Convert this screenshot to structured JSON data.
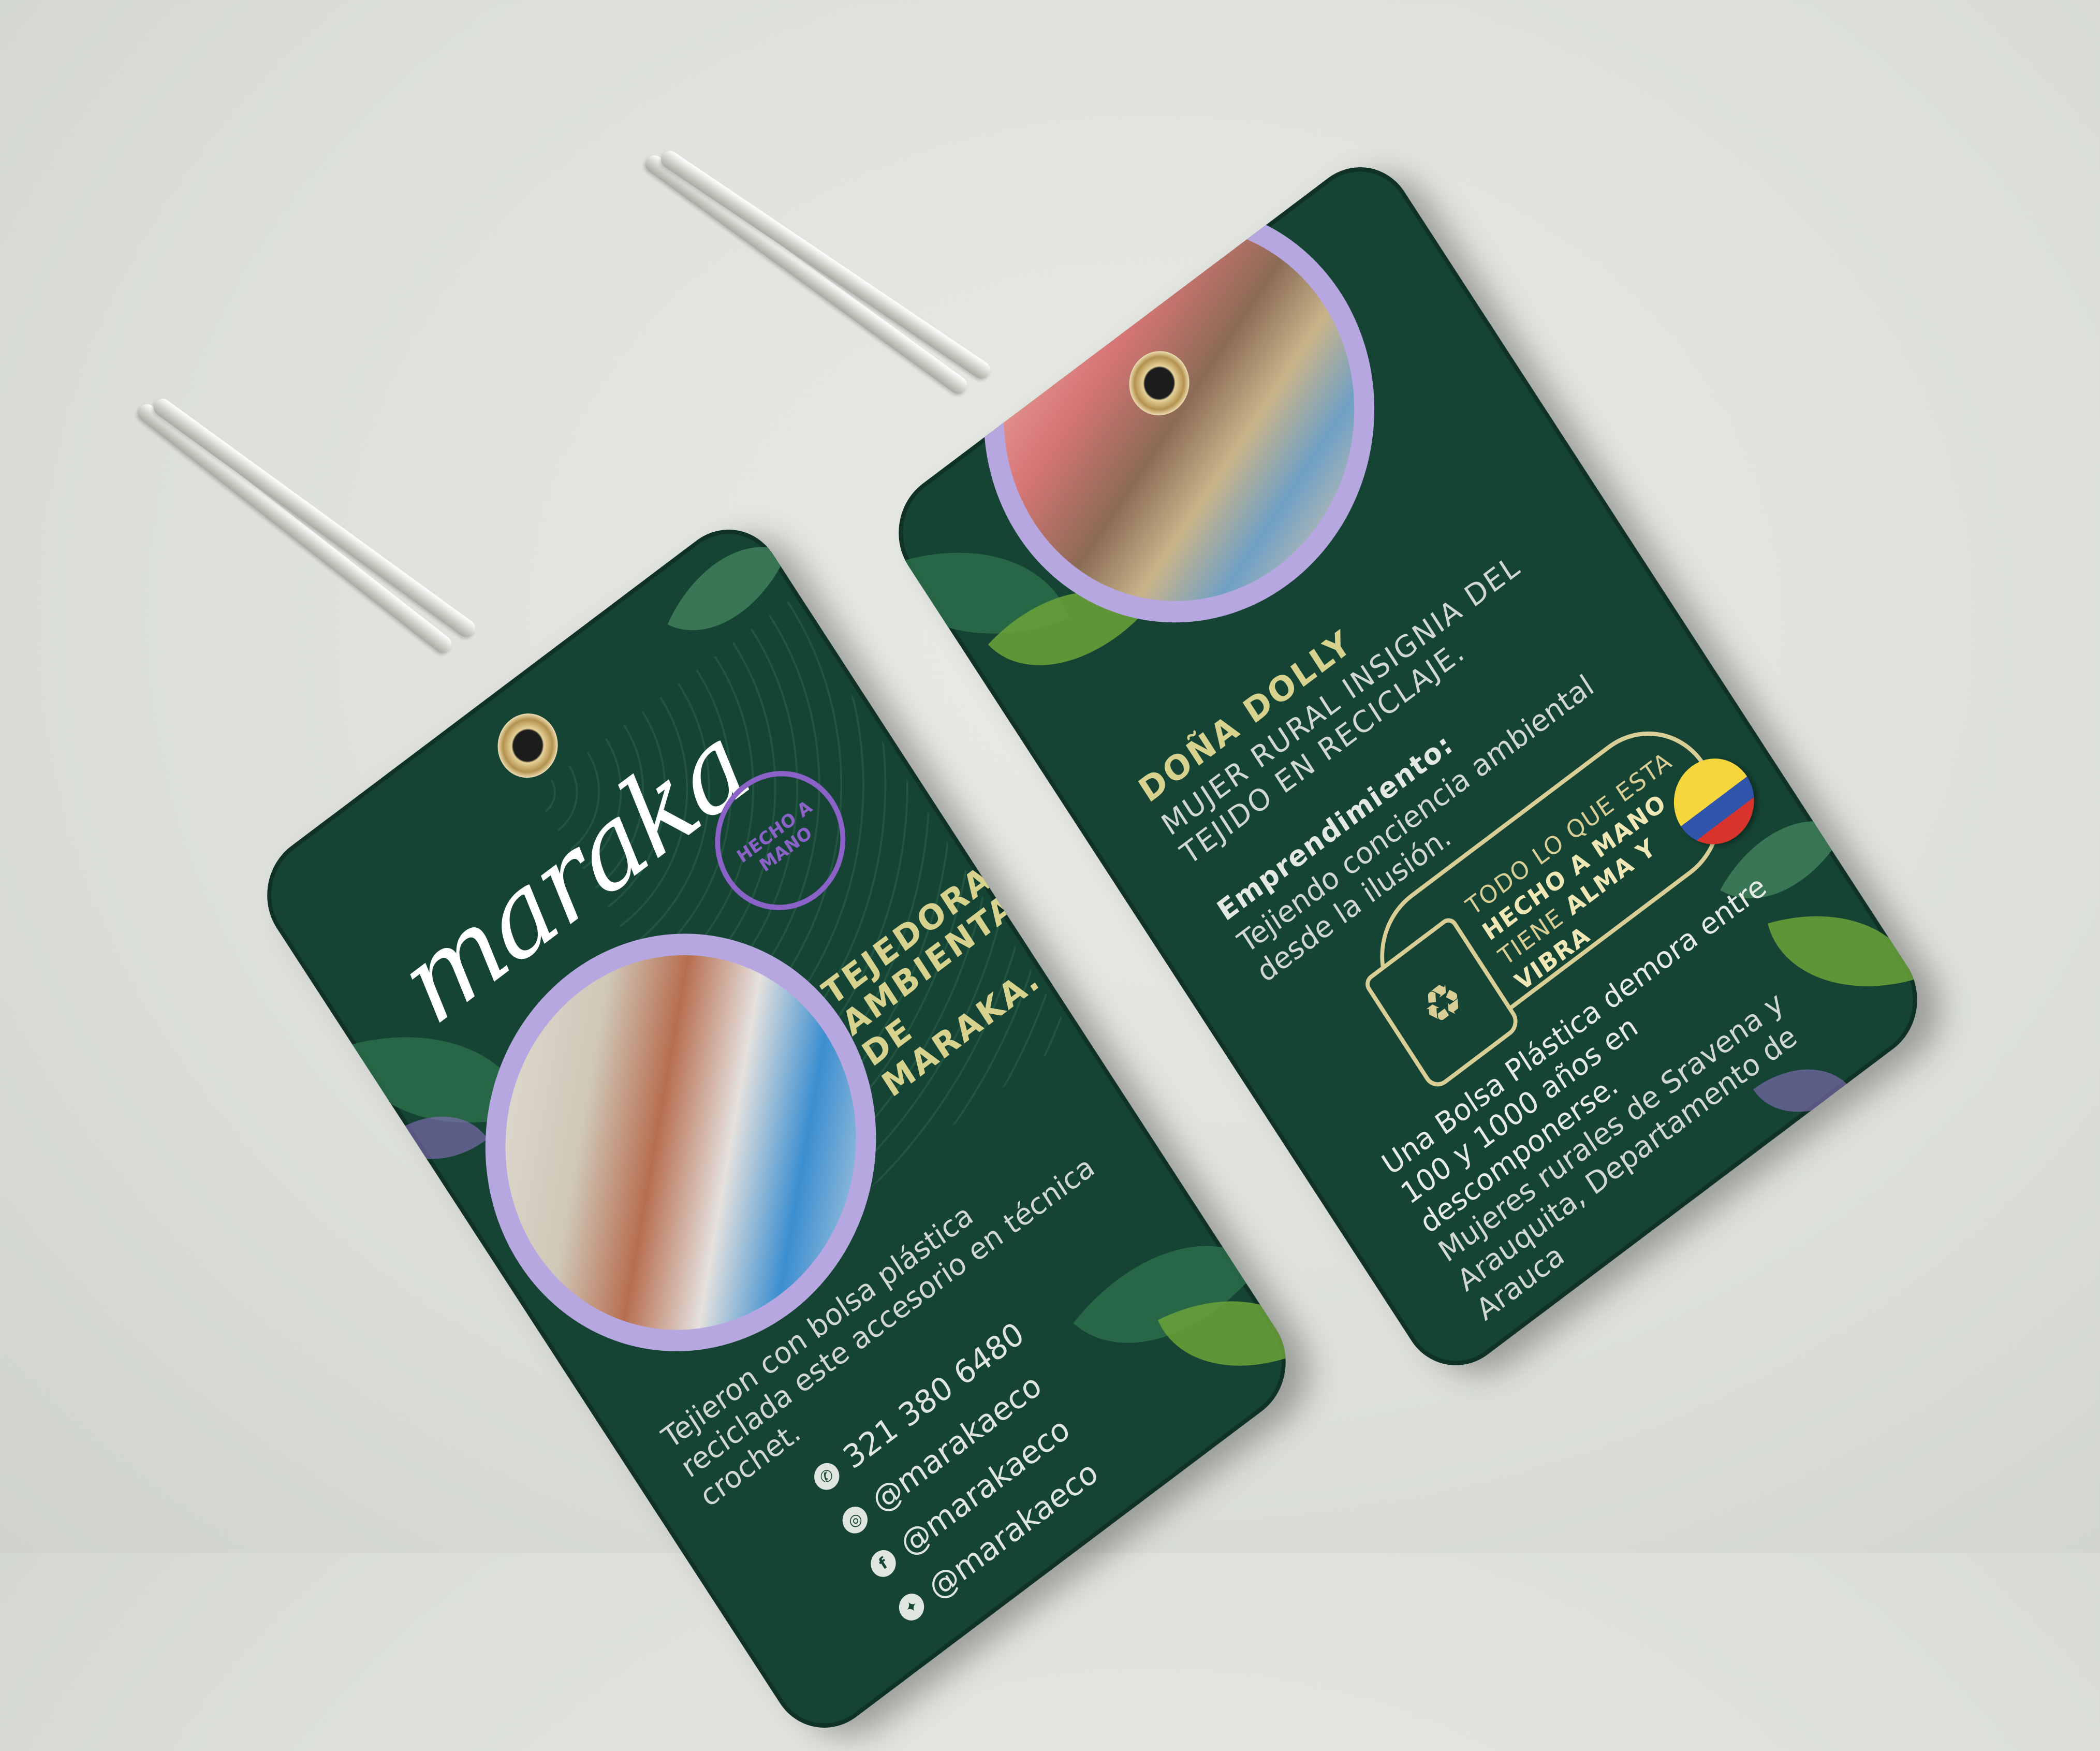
{
  "left_tag": {
    "logo": "maraka",
    "stamp_text": "HECHO A MANO",
    "heading": "TEJEDORAS AMBIENTALES DE MARAKA.",
    "body": "Tejieron con bolsa plástica reciclada este accesorio en técnica crochet.",
    "contacts": [
      {
        "icon": "whatsapp-icon",
        "glyph": "✆",
        "text": "321 380 6480"
      },
      {
        "icon": "instagram-icon",
        "glyph": "◎",
        "text": "@marakaeco"
      },
      {
        "icon": "facebook-icon",
        "glyph": "f",
        "text": "@marakaeco"
      },
      {
        "icon": "twitter-icon",
        "glyph": "✦",
        "text": "@marakaeco"
      }
    ]
  },
  "right_tag": {
    "heading_name": "DOÑA DOLLY",
    "heading_sub": "MUJER RURAL INSIGNIA DEL TEJIDO EN RECICLAJE.",
    "venture_label": "Emprendimiento:",
    "venture_text": "Tejiendo conciencia ambiental desde la ilusión.",
    "badge_line1": "TODO LO QUE ESTA",
    "badge_line2": "HECHO A MANO",
    "badge_line3_pre": "TIENE",
    "badge_line3_bold": "ALMA Y VIBRA",
    "badge_glyph": "♻",
    "plastic_fact": "Una Bolsa Plástica demora entre 100 y 1000 años en descomponerse.",
    "origin": "Mujeres rurales de Sravena y Arauquita, Departamento de Arauca"
  },
  "colors": {
    "tag_green": "#154434",
    "accent_gold": "#d7d28e",
    "accent_lavender": "#b7a7e0",
    "accent_purple": "#8b62c8"
  }
}
